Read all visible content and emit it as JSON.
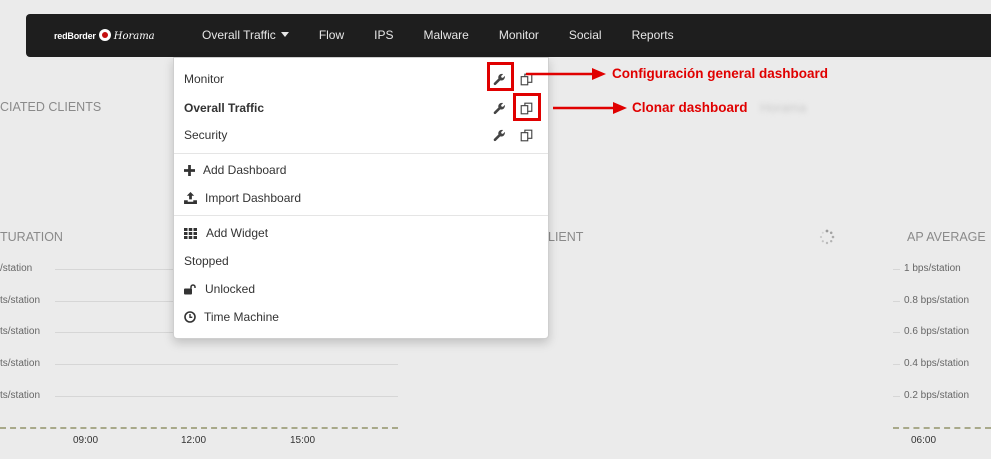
{
  "navbar": {
    "brand": {
      "part1": "redBorder",
      "part2": "Horama"
    },
    "items": [
      {
        "label": "Overall Traffic",
        "has_caret": true
      },
      {
        "label": "Flow"
      },
      {
        "label": "IPS"
      },
      {
        "label": "Malware"
      },
      {
        "label": "Monitor"
      },
      {
        "label": "Social"
      },
      {
        "label": "Reports"
      }
    ]
  },
  "background": {
    "clients_title": "CIATED CLIENTS",
    "saturation_title": "TURATION",
    "client_title": "LIENT",
    "ap_average_title": "AP AVERAGE",
    "left_axis": [
      "/station",
      "ts/station",
      "ts/station",
      "ts/station",
      "ts/station"
    ],
    "left_x_ticks": [
      "09:00",
      "12:00",
      "15:00"
    ],
    "right_axis": [
      "1 bps/station",
      "0.8 bps/station",
      "0.6 bps/station",
      "0.4 bps/station",
      "0.2 bps/station"
    ],
    "right_x_ticks": [
      "06:00"
    ]
  },
  "dropdown": {
    "dashboards": [
      {
        "label": "Monitor",
        "bold": false
      },
      {
        "label": "Overall Traffic",
        "bold": true
      },
      {
        "label": "Security",
        "bold": false
      }
    ],
    "actions": [
      {
        "label": "Add Dashboard",
        "icon": "plus-icon"
      },
      {
        "label": "Import Dashboard",
        "icon": "upload-icon"
      }
    ],
    "widgets": [
      {
        "label": "Add Widget",
        "icon": "grid-icon"
      },
      {
        "label": "Stopped",
        "icon": ""
      },
      {
        "label": "Unlocked",
        "icon": "unlock-icon"
      },
      {
        "label": "Time Machine",
        "icon": "clock-icon"
      }
    ]
  },
  "annotations": {
    "config_label": "Configuración general dashboard",
    "clone_label": "Clonar dashboard",
    "blurred_suffix": "Horama",
    "color": "#e00000"
  }
}
